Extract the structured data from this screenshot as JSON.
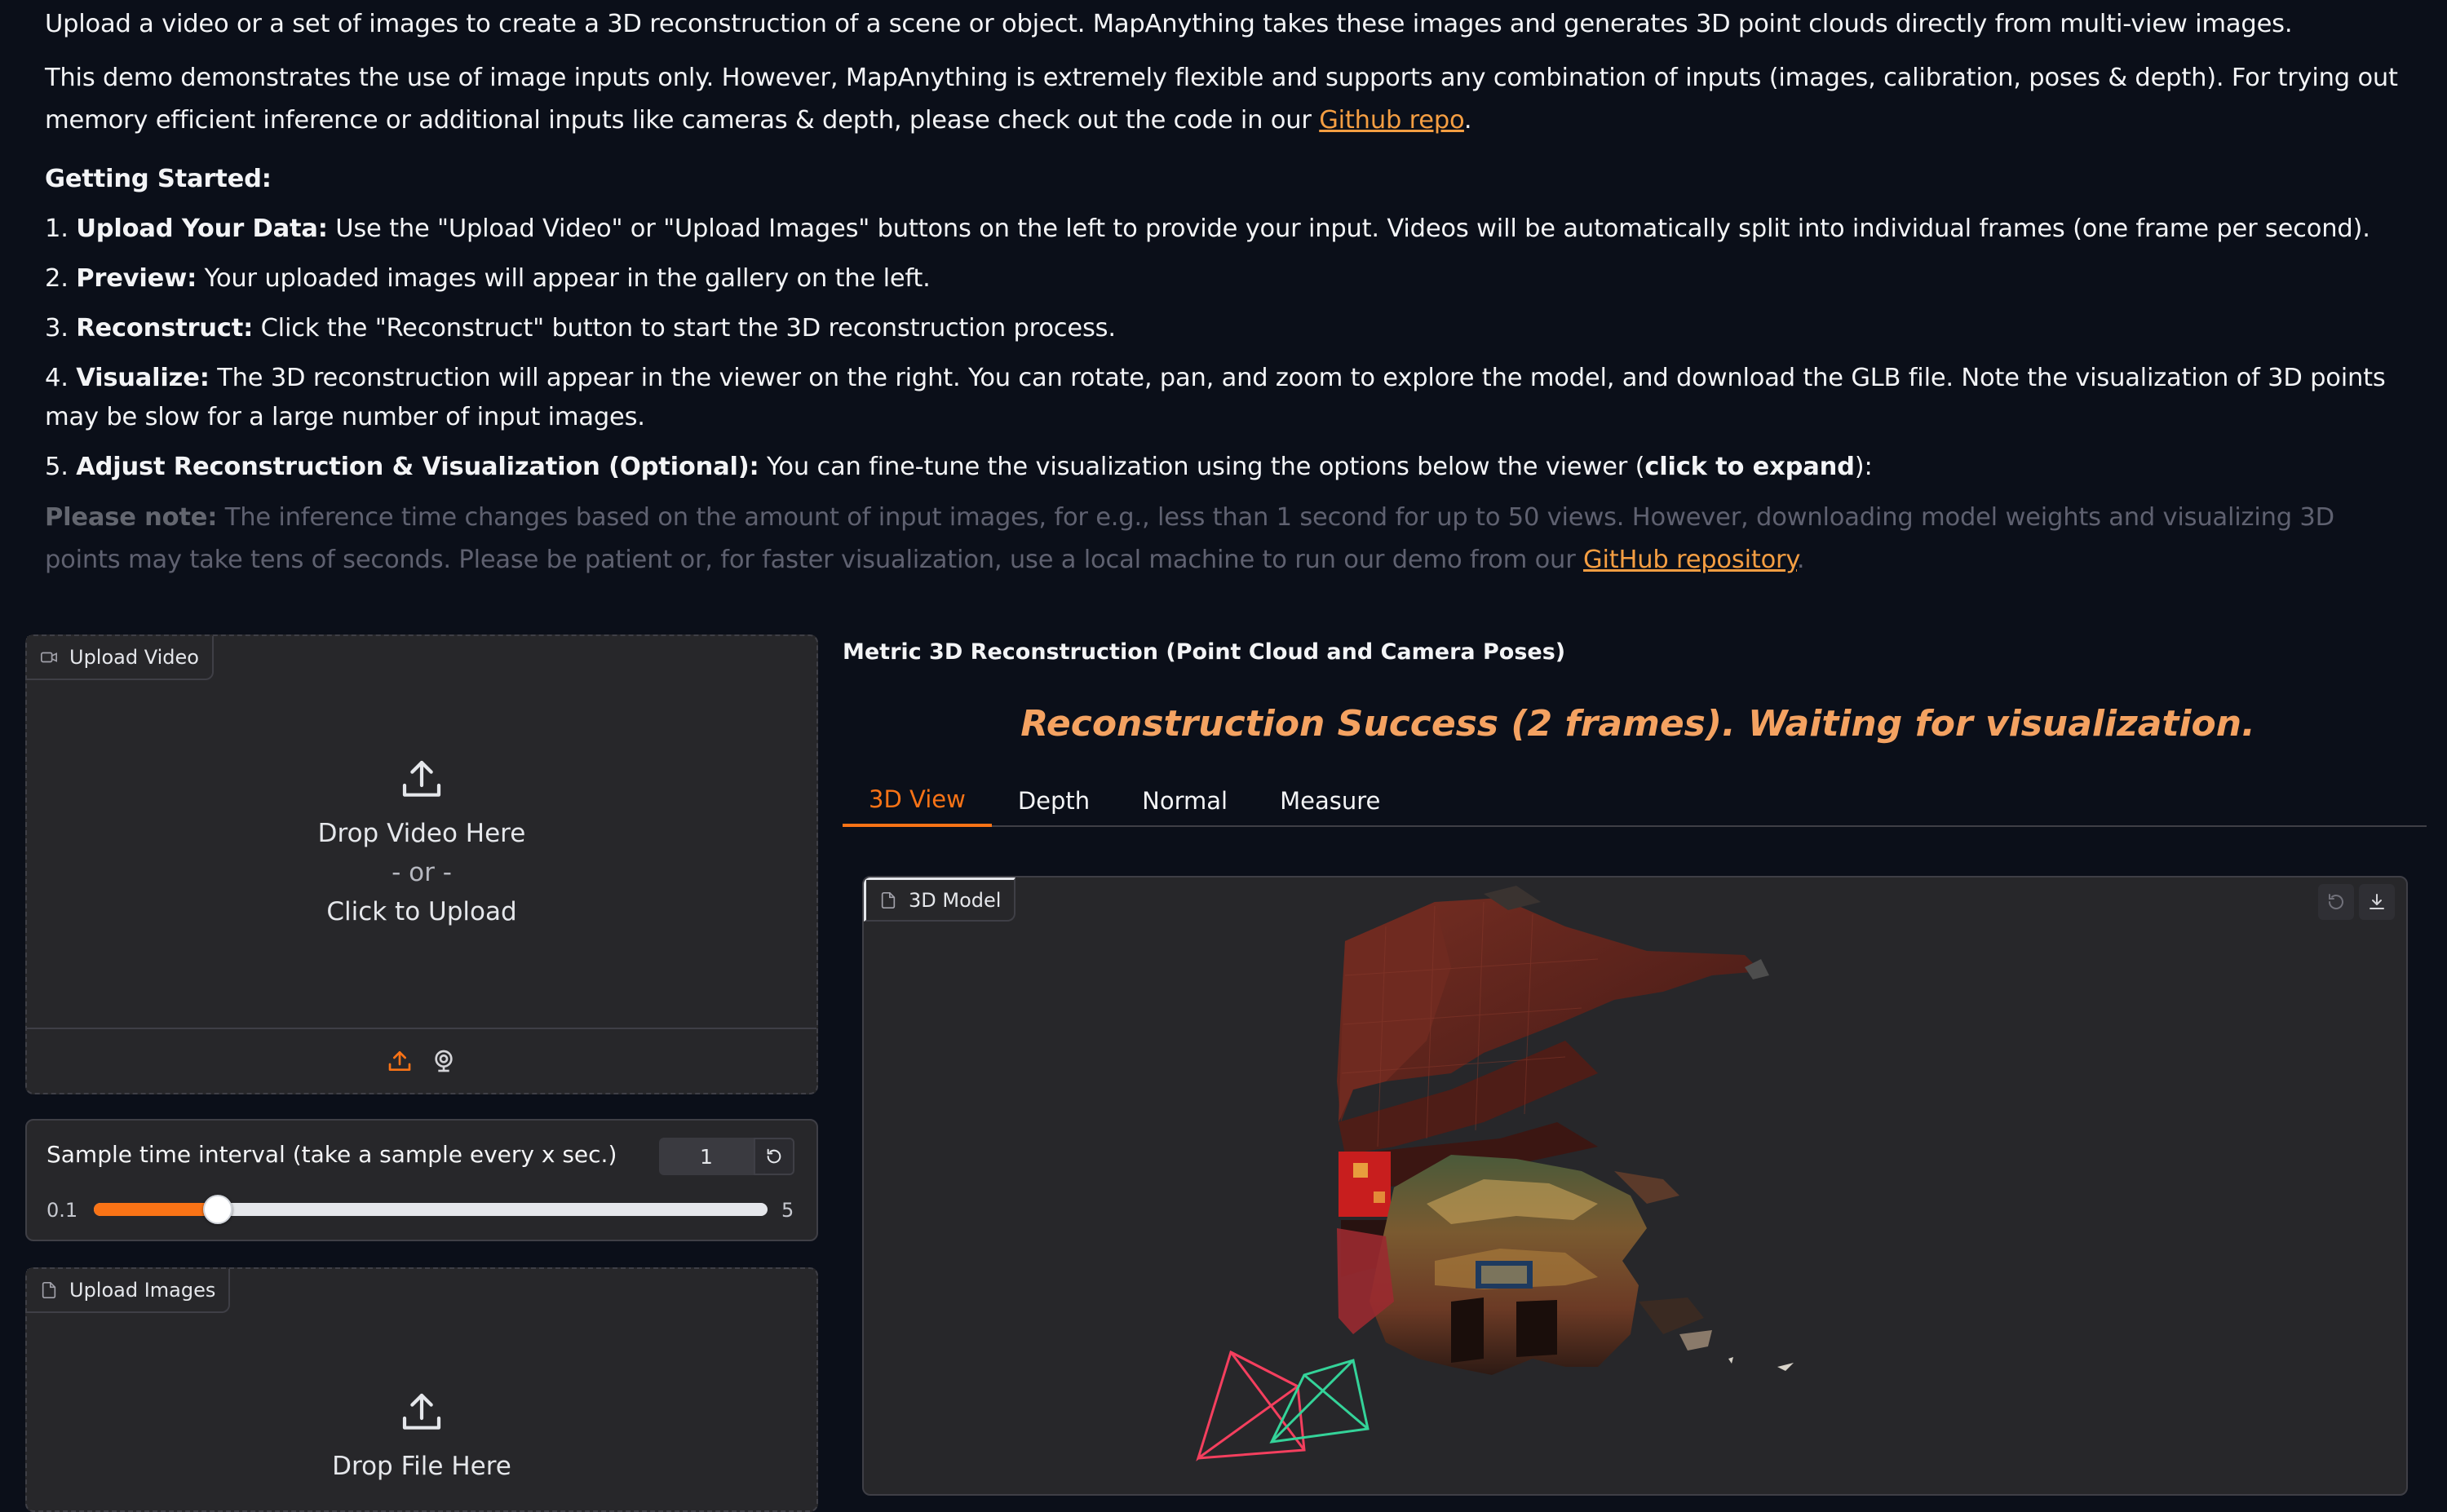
{
  "intro": {
    "p1": "Upload a video or a set of images to create a 3D reconstruction of a scene or object. MapAnything takes these images and generates 3D point clouds directly from multi-view images.",
    "p2_text": "This demo demonstrates the use of image inputs only. However, MapAnything is extremely flexible and supports any combination of inputs (images, calibration, poses & depth). For trying out memory efficient inference or additional inputs like cameras & depth, please check out the code in our ",
    "p2_link": "Github repo",
    "getting_started": "Getting Started:",
    "steps": [
      {
        "num": "1.",
        "bold": "Upload Your Data:",
        "text": " Use the \"Upload Video\" or \"Upload Images\" buttons on the left to provide your input. Videos will be automatically split into individual frames (one frame per second)."
      },
      {
        "num": "2.",
        "bold": "Preview:",
        "text": " Your uploaded images will appear in the gallery on the left."
      },
      {
        "num": "3.",
        "bold": "Reconstruct:",
        "text": " Click the \"Reconstruct\" button to start the 3D reconstruction process."
      },
      {
        "num": "4.",
        "bold": "Visualize:",
        "text": " The 3D reconstruction will appear in the viewer on the right. You can rotate, pan, and zoom to explore the model, and download the GLB file. Note the visualization of 3D points may be slow for a large number of input images."
      },
      {
        "num": "5.",
        "bold": "Adjust Reconstruction & Visualization (Optional):",
        "text": " You can fine-tune the visualization using the options below the viewer (",
        "bold2": "click to expand",
        "tail": "):"
      }
    ],
    "note_label": "Please note:",
    "note_text": " The inference time changes based on the amount of input images, for e.g., less than 1 second for up to 50 views. However, downloading model weights and visualizing 3D points may take tens of seconds. Please be patient or, for faster visualization, use a local machine to run our demo from our ",
    "note_link": "GitHub repository"
  },
  "upload_video": {
    "tag": "Upload Video",
    "drop": "Drop Video Here",
    "or": "- or -",
    "click": "Click to Upload"
  },
  "sample_interval": {
    "label": "Sample time interval (take a sample every x sec.)",
    "value": "1",
    "min": "0.1",
    "max": "5",
    "numeric_min": 0.1,
    "numeric_max": 5,
    "numeric_value": 1
  },
  "upload_images": {
    "tag": "Upload Images",
    "drop": "Drop File Here"
  },
  "viewer": {
    "section_title": "Metric 3D Reconstruction (Point Cloud and Camera Poses)",
    "status": "Reconstruction Success (2 frames). Waiting for visualization.",
    "tabs": [
      "3D View",
      "Depth",
      "Normal",
      "Measure"
    ],
    "active_tab": 0,
    "model_tag": "3D Model"
  },
  "colors": {
    "accent": "#f97316",
    "status": "#f4a261",
    "link": "#f59e42",
    "camera_1": "#f43f5e",
    "camera_2": "#34d399"
  }
}
